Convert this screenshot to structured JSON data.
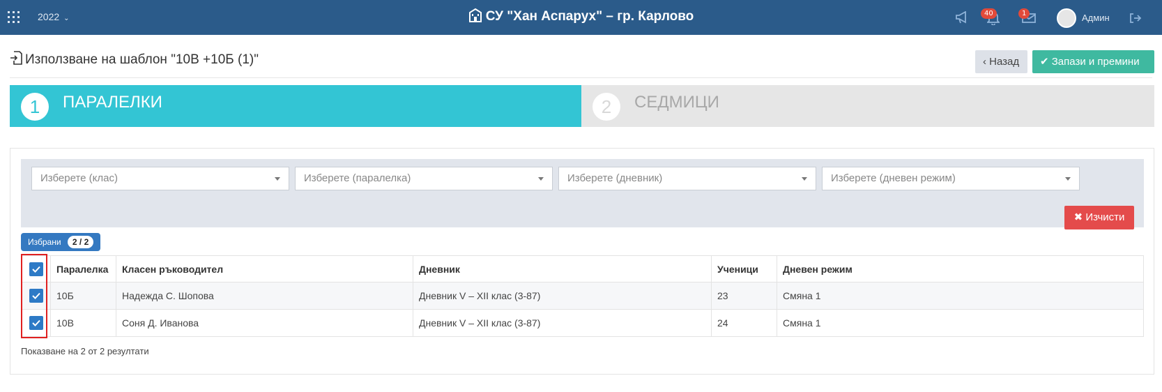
{
  "topbar": {
    "year": "2022",
    "school_name": "СУ \"Хан Аспарух\" – гр. Карлово",
    "notifications_count": "40",
    "messages_count": "1",
    "user_name": "Админ",
    "color": "#2b5b8a"
  },
  "page": {
    "title": "Използване на шаблон \"10В +10Б (1)\"",
    "back_label": "Назад",
    "save_label": "Запази и премини"
  },
  "wizard": {
    "steps": [
      {
        "number": "1",
        "label": "ПАРАЛЕЛКИ",
        "active": true
      },
      {
        "number": "2",
        "label": "СЕДМИЦИ",
        "active": false
      }
    ]
  },
  "filters": {
    "class_placeholder": "Изберете (клас)",
    "section_placeholder": "Изберете (паралелка)",
    "journal_placeholder": "Изберете (дневник)",
    "regime_placeholder": "Изберете (дневен режим)",
    "clear_label": "Изчисти"
  },
  "selection": {
    "label": "Избрани",
    "count": "2 / 2"
  },
  "table": {
    "columns": [
      "Паралелка",
      "Класен ръководител",
      "Дневник",
      "Ученици",
      "Дневен режим"
    ],
    "rows": [
      {
        "section": "10Б",
        "teacher": "Надежда С. Шопова",
        "journal": "Дневник V – XII клас (3-87)",
        "students": "23",
        "regime": "Смяна 1",
        "checked": true
      },
      {
        "section": "10В",
        "teacher": "Соня Д. Иванова",
        "journal": "Дневник V – XII клас (3-87)",
        "students": "24",
        "regime": "Смяна 1",
        "checked": true
      }
    ]
  },
  "footer": {
    "result_info": "Показване на 2 от 2 резултати"
  },
  "colors": {
    "accent": "#33c5d4",
    "save": "#3fb9a0",
    "clear": "#e44b4b",
    "checkbox": "#2d7ac6"
  }
}
